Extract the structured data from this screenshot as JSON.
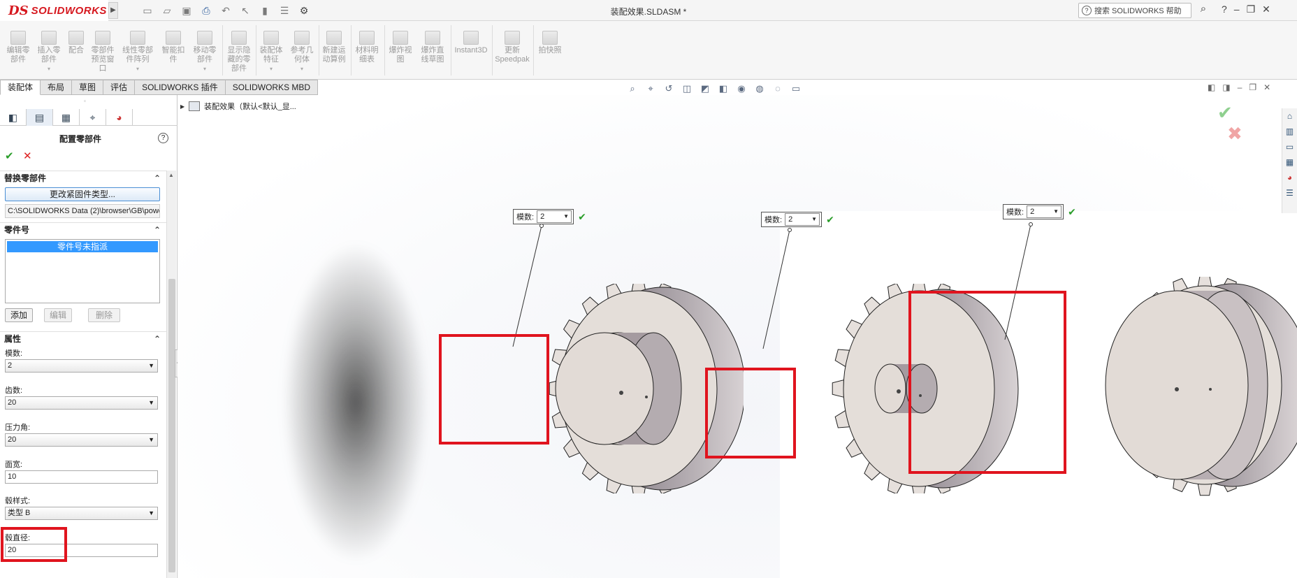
{
  "app": {
    "logo_prefix": "DS",
    "logo_text": "SOLIDWORKS",
    "document_title": "装配效果.SLDASM *"
  },
  "help": {
    "search_placeholder": "搜索 SOLIDWORKS 帮助",
    "question": "?"
  },
  "quick_access": [
    "new-icon",
    "open-icon",
    "save-icon",
    "print-icon",
    "undo-icon",
    "select-icon",
    "rebuild-icon",
    "file-props-icon",
    "options-icon"
  ],
  "window_controls": {
    "help": "?",
    "minimize": "–",
    "restore": "❐",
    "close": "✕"
  },
  "ribbon": {
    "tools": [
      {
        "label": "编辑零\n部件"
      },
      {
        "label": "插入零\n部件"
      },
      {
        "label": "配合"
      },
      {
        "label": "零部件\n预览窗\n口"
      },
      {
        "label": "线性零部\n件阵列"
      },
      {
        "label": "智能扣\n件"
      },
      {
        "label": "移动零\n部件"
      },
      {
        "label": "显示隐\n藏的零\n部件"
      },
      {
        "label": "装配体\n特征"
      },
      {
        "label": "参考几\n何体"
      },
      {
        "label": "新建运\n动算例"
      },
      {
        "label": "材料明\n细表"
      },
      {
        "label": "爆炸视\n图"
      },
      {
        "label": "爆炸直\n线草图"
      },
      {
        "label": "Instant3D"
      },
      {
        "label": "更新\nSpeedpak"
      },
      {
        "label": "拍快照"
      }
    ]
  },
  "tabs": [
    "装配体",
    "布局",
    "草图",
    "评估",
    "SOLIDWORKS 插件",
    "SOLIDWORKS MBD"
  ],
  "feature_tree": {
    "root": "装配效果（默认<默认_显..."
  },
  "property_manager": {
    "title": "配置零部件",
    "help": "?",
    "ok": "✔",
    "cancel": "✕",
    "replace_group": {
      "title": "替换零部件",
      "change_button": "更改紧固件类型...",
      "path": "C:\\SOLIDWORKS Data (2)\\browser\\GB\\powe"
    },
    "part_number_group": {
      "title": "零件号",
      "selected": "零件号未指派",
      "add": "添加",
      "edit": "编辑",
      "delete": "删除"
    },
    "properties_group": {
      "title": "属性",
      "module_label": "模数:",
      "module_value": "2",
      "teeth_label": "齿数:",
      "teeth_value": "20",
      "pressure_label": "压力角:",
      "pressure_value": "20",
      "face_width_label": "面宽:",
      "face_width_value": "10",
      "hub_style_label": "毂样式:",
      "hub_style_value": "类型 B",
      "hub_diameter_label": "毂直径:",
      "hub_diameter_value": "20"
    }
  },
  "callouts": [
    {
      "label": "模数:",
      "value": "2"
    },
    {
      "label": "模数:",
      "value": "2"
    },
    {
      "label": "模数:",
      "value": "2"
    }
  ],
  "colors": {
    "highlight_red": "#e0141e",
    "accent_blue": "#3399ff",
    "ok_green": "#2a9d2a"
  }
}
